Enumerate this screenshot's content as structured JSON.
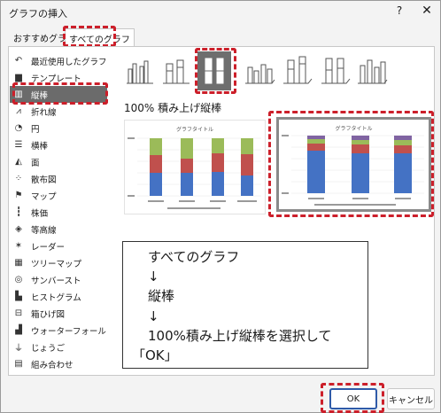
{
  "window": {
    "title": "グラフの挿入",
    "help_label": "?",
    "close_label": "✕"
  },
  "tabs": [
    {
      "label": "おすすめグラフ"
    },
    {
      "label": "すべてのグラフ"
    }
  ],
  "sidebar": {
    "items": [
      {
        "label": "最近使用したグラフ",
        "icon": "undo-icon",
        "glyph": "↶"
      },
      {
        "label": "テンプレート",
        "icon": "folder-icon",
        "glyph": "▆"
      },
      {
        "label": "縦棒",
        "icon": "column-chart-icon",
        "glyph": "▥"
      },
      {
        "label": "折れ線",
        "icon": "line-chart-icon",
        "glyph": "⩘"
      },
      {
        "label": "円",
        "icon": "pie-chart-icon",
        "glyph": "◔"
      },
      {
        "label": "横棒",
        "icon": "bar-chart-icon",
        "glyph": "☰"
      },
      {
        "label": "面",
        "icon": "area-chart-icon",
        "glyph": "◭"
      },
      {
        "label": "散布図",
        "icon": "scatter-chart-icon",
        "glyph": "⁘"
      },
      {
        "label": "マップ",
        "icon": "map-chart-icon",
        "glyph": "⚑"
      },
      {
        "label": "株価",
        "icon": "stock-chart-icon",
        "glyph": "┇"
      },
      {
        "label": "等高線",
        "icon": "surface-chart-icon",
        "glyph": "◈"
      },
      {
        "label": "レーダー",
        "icon": "radar-chart-icon",
        "glyph": "✶"
      },
      {
        "label": "ツリーマップ",
        "icon": "treemap-icon",
        "glyph": "▦"
      },
      {
        "label": "サンバースト",
        "icon": "sunburst-icon",
        "glyph": "◎"
      },
      {
        "label": "ヒストグラム",
        "icon": "histogram-icon",
        "glyph": "▙"
      },
      {
        "label": "箱ひげ図",
        "icon": "box-whisker-icon",
        "glyph": "⊟"
      },
      {
        "label": "ウォーターフォール",
        "icon": "waterfall-icon",
        "glyph": "▟"
      },
      {
        "label": "じょうご",
        "icon": "funnel-icon",
        "glyph": "⏚"
      },
      {
        "label": "組み合わせ",
        "icon": "combo-chart-icon",
        "glyph": "▤"
      }
    ]
  },
  "subtypes_selected_title": "100% 積み上げ縦棒",
  "previews": [
    {
      "chart_title": "グラフタイトル"
    },
    {
      "chart_title": "グラフタイトル"
    }
  ],
  "note": {
    "line1": "すべてのグラフ",
    "arrow1": "↓",
    "line2": "縦棒",
    "arrow2": "↓",
    "line3": "100%積み上げ縦棒を選択して",
    "line4": "「OK」"
  },
  "buttons": {
    "ok": "OK",
    "cancel": "キャンセル"
  },
  "colors": {
    "highlight": "#cc1f2a",
    "series1": "#4472c4",
    "series2": "#c0504d",
    "series3": "#9bbb59",
    "series4": "#8064a2",
    "selected_bg": "#6b6b6b"
  }
}
